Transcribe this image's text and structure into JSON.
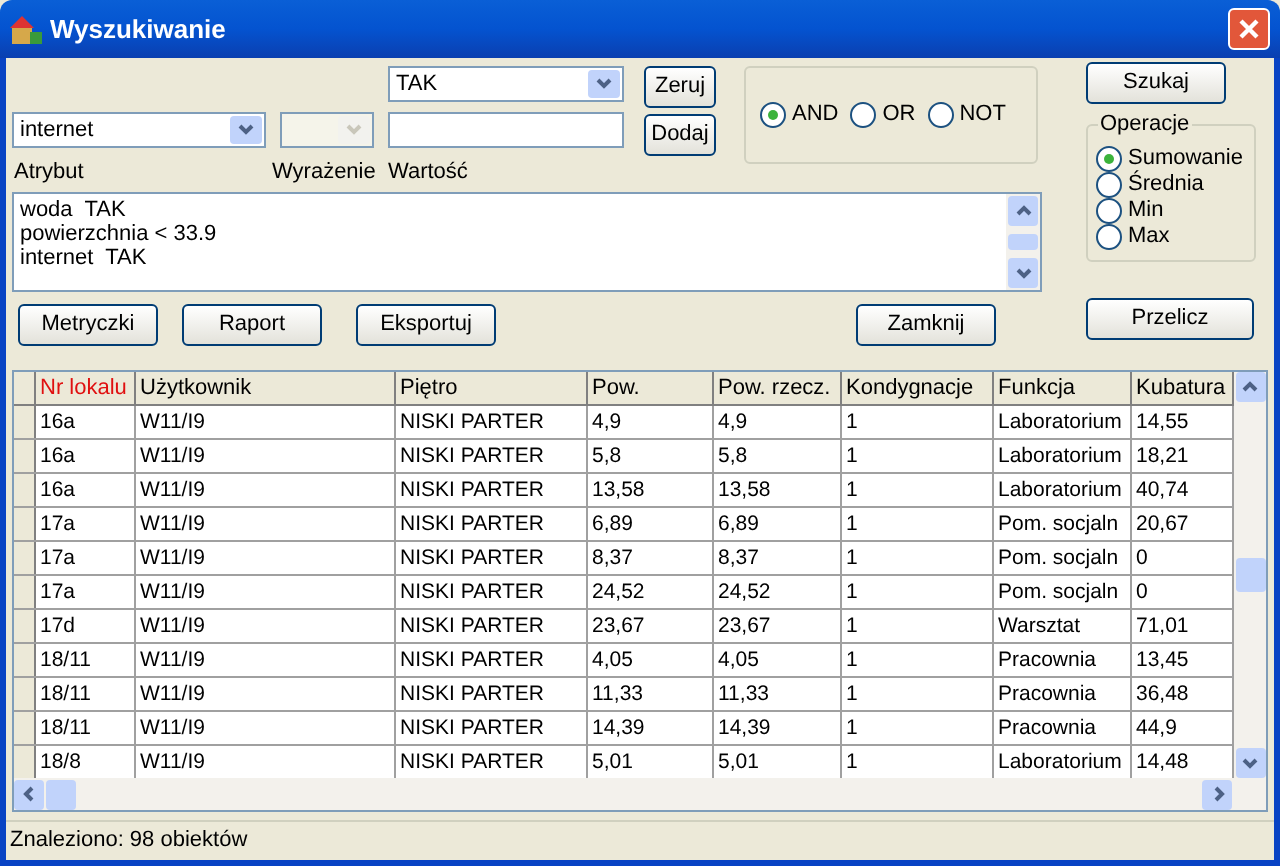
{
  "window": {
    "title": "Wyszukiwanie"
  },
  "attribute": {
    "label": "Atrybut",
    "value": "internet"
  },
  "expression": {
    "label": "Wyrażenie",
    "disabled": true
  },
  "value": {
    "label": "Wartość",
    "combo_value": "TAK"
  },
  "buttons_small": [
    "Zeruj",
    "Dodaj"
  ],
  "logic": [
    {
      "label": "AND",
      "selected": true
    },
    {
      "label": "OR",
      "selected": false
    },
    {
      "label": "NOT",
      "selected": false
    }
  ],
  "query_lines": [
    "woda  TAK",
    "powierzchnia < 33.9",
    "internet  TAK"
  ],
  "actions": [
    "Metryczki",
    "Raport",
    "Eksportuj"
  ],
  "close_button": "Zamknij",
  "search_button": "Szukaj",
  "operations": {
    "title": "Operacje",
    "options": [
      {
        "label": "Sumowanie",
        "selected": true
      },
      {
        "label": "Średnia",
        "selected": false
      },
      {
        "label": "Min",
        "selected": false
      },
      {
        "label": "Max",
        "selected": false
      }
    ]
  },
  "recalc_button": "Przelicz",
  "table": {
    "columns": [
      {
        "label": "Nr lokalu",
        "sorted": true
      },
      {
        "label": "Użytkownik",
        "sorted": false
      },
      {
        "label": "Piętro",
        "sorted": false
      },
      {
        "label": "Pow.",
        "sorted": false
      },
      {
        "label": "Pow. rzecz.",
        "sorted": false
      },
      {
        "label": "Kondygnacje",
        "sorted": false
      },
      {
        "label": "Funkcja",
        "sorted": false
      },
      {
        "label": "Kubatura",
        "sorted": false
      }
    ],
    "rows": [
      [
        "16a",
        "W11/I9",
        "NISKI PARTER",
        "4,9",
        "4,9",
        "1",
        "Laboratorium",
        "14,55"
      ],
      [
        "16a",
        "W11/I9",
        "NISKI PARTER",
        "5,8",
        "5,8",
        "1",
        "Laboratorium",
        "18,21"
      ],
      [
        "16a",
        "W11/I9",
        "NISKI PARTER",
        "13,58",
        "13,58",
        "1",
        "Laboratorium",
        "40,74"
      ],
      [
        "17a",
        "W11/I9",
        "NISKI PARTER",
        "6,89",
        "6,89",
        "1",
        "Pom. socjaln",
        "20,67"
      ],
      [
        "17a",
        "W11/I9",
        "NISKI PARTER",
        "8,37",
        "8,37",
        "1",
        "Pom. socjaln",
        "0"
      ],
      [
        "17a",
        "W11/I9",
        "NISKI PARTER",
        "24,52",
        "24,52",
        "1",
        "Pom. socjaln",
        "0"
      ],
      [
        "17d",
        "W11/I9",
        "NISKI PARTER",
        "23,67",
        "23,67",
        "1",
        "Warsztat",
        "71,01"
      ],
      [
        "18/11",
        "W11/I9",
        "NISKI PARTER",
        "4,05",
        "4,05",
        "1",
        "Pracownia",
        "13,45"
      ],
      [
        "18/11",
        "W11/I9",
        "NISKI PARTER",
        "11,33",
        "11,33",
        "1",
        "Pracownia",
        "36,48"
      ],
      [
        "18/11",
        "W11/I9",
        "NISKI PARTER",
        "14,39",
        "14,39",
        "1",
        "Pracownia",
        "44,9"
      ],
      [
        "18/8",
        "W11/I9",
        "NISKI PARTER",
        "5,01",
        "5,01",
        "1",
        "Laboratorium",
        "14,48"
      ]
    ]
  },
  "status": "Znaleziono: 98 obiektów"
}
